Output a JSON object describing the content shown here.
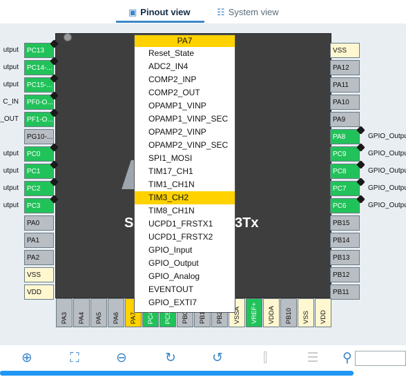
{
  "tabs": {
    "pinout": "Pinout view",
    "system": "System view"
  },
  "chip": {
    "name_left": "S",
    "name_right": "3Tx"
  },
  "left_pins": [
    {
      "label": "PC13",
      "cls": "g",
      "signal": "utput"
    },
    {
      "label": "PC14-...",
      "cls": "g",
      "signal": "utput"
    },
    {
      "label": "PC15-...",
      "cls": "g",
      "signal": "utput"
    },
    {
      "label": "PF0-O...",
      "cls": "g",
      "signal": "C_IN"
    },
    {
      "label": "PF1-O...",
      "cls": "g",
      "signal": "_OUT"
    },
    {
      "label": "PG10-...",
      "cls": "gr",
      "signal": ""
    },
    {
      "label": "PC0",
      "cls": "g",
      "signal": "utput"
    },
    {
      "label": "PC1",
      "cls": "g",
      "signal": "utput"
    },
    {
      "label": "PC2",
      "cls": "g",
      "signal": "utput"
    },
    {
      "label": "PC3",
      "cls": "g",
      "signal": "utput"
    },
    {
      "label": "PA0",
      "cls": "gr",
      "signal": ""
    },
    {
      "label": "PA1",
      "cls": "gr",
      "signal": ""
    },
    {
      "label": "PA2",
      "cls": "gr",
      "signal": ""
    },
    {
      "label": "VSS",
      "cls": "y",
      "signal": ""
    },
    {
      "label": "VDD",
      "cls": "y",
      "signal": ""
    }
  ],
  "right_pins": [
    {
      "label": "VSS",
      "cls": "y",
      "signal": ""
    },
    {
      "label": "PA12",
      "cls": "gr",
      "signal": ""
    },
    {
      "label": "PA11",
      "cls": "gr",
      "signal": ""
    },
    {
      "label": "PA10",
      "cls": "gr",
      "signal": ""
    },
    {
      "label": "PA9",
      "cls": "gr",
      "signal": ""
    },
    {
      "label": "PA8",
      "cls": "g",
      "signal": "GPIO_Output"
    },
    {
      "label": "PC9",
      "cls": "g",
      "signal": "GPIO_Output"
    },
    {
      "label": "PC8",
      "cls": "g",
      "signal": "GPIO_Output"
    },
    {
      "label": "PC7",
      "cls": "g",
      "signal": "GPIO_Output"
    },
    {
      "label": "PC6",
      "cls": "g",
      "signal": "GPIO_Output"
    },
    {
      "label": "PB15",
      "cls": "gr",
      "signal": ""
    },
    {
      "label": "PB14",
      "cls": "gr",
      "signal": ""
    },
    {
      "label": "PB13",
      "cls": "gr",
      "signal": ""
    },
    {
      "label": "PB12",
      "cls": "gr",
      "signal": ""
    },
    {
      "label": "PB11",
      "cls": "gr",
      "signal": ""
    }
  ],
  "bottom_pins": [
    {
      "label": "PA3",
      "cls": "gr"
    },
    {
      "label": "PA4",
      "cls": "gr"
    },
    {
      "label": "PA5",
      "cls": "gr"
    },
    {
      "label": "PA6",
      "cls": "gr"
    },
    {
      "label": "PA7",
      "cls": "ye"
    },
    {
      "label": "PC4",
      "cls": "g"
    },
    {
      "label": "PC5",
      "cls": "g"
    },
    {
      "label": "PB0",
      "cls": "gr"
    },
    {
      "label": "PB1",
      "cls": "gr"
    },
    {
      "label": "PB2",
      "cls": "gr"
    },
    {
      "label": "VSSA",
      "cls": "y"
    },
    {
      "label": "VREF+",
      "cls": "g"
    },
    {
      "label": "VDDA",
      "cls": "y"
    },
    {
      "label": "PB10",
      "cls": "gr"
    },
    {
      "label": "VSS",
      "cls": "y"
    },
    {
      "label": "VDD",
      "cls": "y"
    }
  ],
  "popup": {
    "title": "PA7",
    "items": [
      "Reset_State",
      "ADC2_IN4",
      "COMP2_INP",
      "COMP2_OUT",
      "OPAMP1_VINP",
      "OPAMP1_VINP_SEC",
      "OPAMP2_VINP",
      "OPAMP2_VINP_SEC",
      "SPI1_MOSI",
      "TIM17_CH1",
      "TIM1_CH1N",
      "TIM3_CH2",
      "TIM8_CH1N",
      "UCPD1_FRSTX1",
      "UCPD1_FRSTX2",
      "GPIO_Input",
      "GPIO_Output",
      "GPIO_Analog",
      "EVENTOUT",
      "GPIO_EXTI7"
    ],
    "selected_index": 11
  },
  "toolbar": {
    "buttons": [
      {
        "name": "zoom-in-icon",
        "glyph": "⊕",
        "enabled": true
      },
      {
        "name": "fit-screen-icon",
        "glyph": "⛶",
        "enabled": true
      },
      {
        "name": "zoom-out-icon",
        "glyph": "⊖",
        "enabled": true
      },
      {
        "name": "rotate-right-icon",
        "glyph": "↻",
        "enabled": true
      },
      {
        "name": "rotate-left-icon",
        "glyph": "↺",
        "enabled": true
      },
      {
        "name": "flip-vertical-icon",
        "glyph": "⫿",
        "enabled": false
      },
      {
        "name": "flip-horizontal-icon",
        "glyph": "☰",
        "enabled": false
      },
      {
        "name": "search-icon",
        "glyph": "⚲",
        "enabled": true
      }
    ],
    "search_placeholder": ""
  }
}
